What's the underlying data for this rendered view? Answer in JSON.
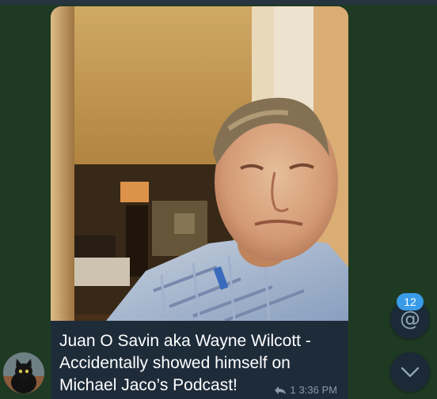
{
  "message": {
    "caption": "Juan O Savin aka Wayne Wilcott - Accidentally showed himself on Michael Jaco’s Podcast!",
    "reply_count": "1",
    "time": "3:36 PM"
  },
  "sender": {
    "avatar_icon": "black-cat-avatar"
  },
  "controls": {
    "mention_badge": "12",
    "mention_icon": "at-sign-icon",
    "scroll_down_icon": "chevron-down-icon"
  },
  "colors": {
    "chat_background": "#1f3a23",
    "bubble_background": "#1e2c3a",
    "badge": "#3a9be8",
    "meta_text": "#8a9aa8"
  }
}
